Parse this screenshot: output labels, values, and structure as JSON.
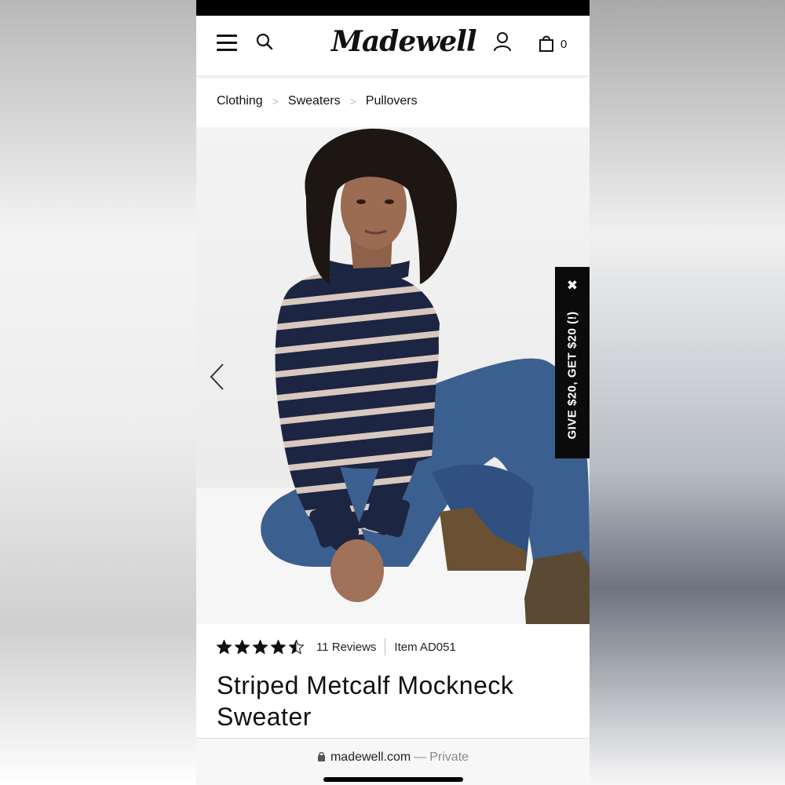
{
  "brand": {
    "logo_text": "Madewell"
  },
  "header": {
    "bag_count": "0"
  },
  "breadcrumb": {
    "items": [
      "Clothing",
      "Sweaters",
      "Pullovers"
    ],
    "separator": ">"
  },
  "promo": {
    "text": "GIVE $20, GET $20 (!)",
    "close_glyph": "✖"
  },
  "product": {
    "rating": 4.5,
    "reviews_label": "11 Reviews",
    "item_label": "Item AD051",
    "title": "Striped Metcalf Mockneck Sweater"
  },
  "browser": {
    "domain": "madewell.com",
    "separator": "—",
    "privacy": "Private"
  },
  "colors": {
    "sweater_navy": "#1c2541",
    "stripe": "#d9c8c0",
    "denim": "#3b5f8f",
    "boot": "#6b5133",
    "promo_bg": "#0b0b0b"
  },
  "icons": [
    "hamburger-menu-icon",
    "search-icon",
    "account-icon",
    "shopping-bag-icon",
    "chevron-left-icon",
    "close-icon",
    "star-icon",
    "lock-icon"
  ]
}
